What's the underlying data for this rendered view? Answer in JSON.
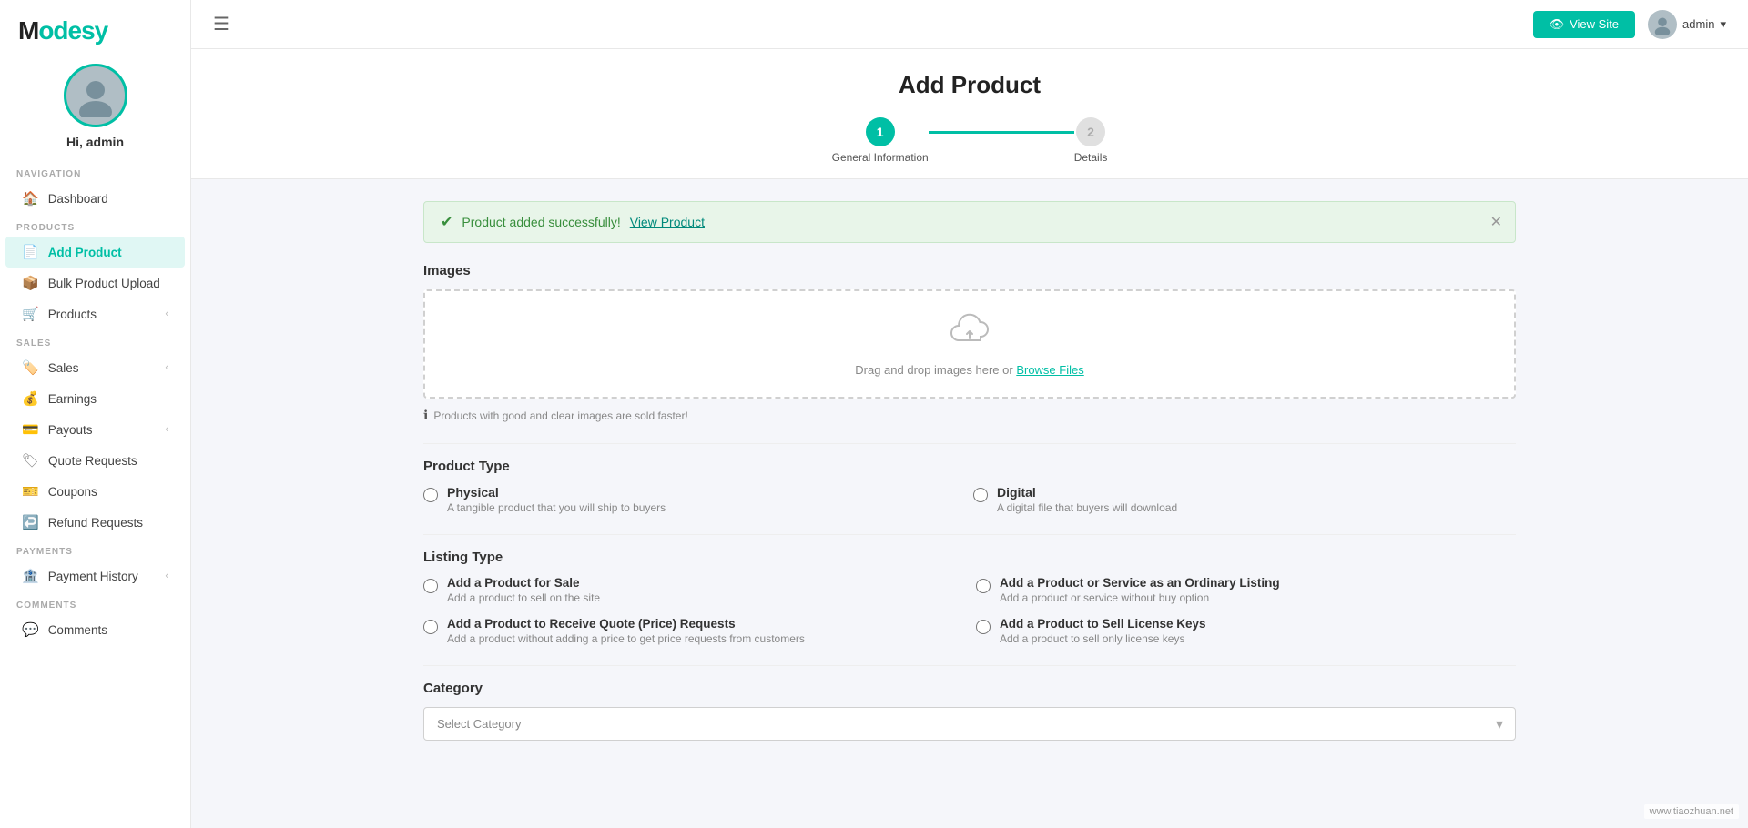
{
  "brand": {
    "name_start": "M",
    "name_rest": "odesy"
  },
  "sidebar": {
    "greeting": "Hi, admin",
    "sections": [
      {
        "label": "NAVIGATION",
        "items": [
          {
            "id": "dashboard",
            "icon": "🏠",
            "text": "Dashboard",
            "active": false,
            "chevron": false
          }
        ]
      },
      {
        "label": "PRODUCTS",
        "items": [
          {
            "id": "add-product",
            "icon": "📄",
            "text": "Add Product",
            "active": true,
            "chevron": false
          },
          {
            "id": "bulk-upload",
            "icon": "📦",
            "text": "Bulk Product Upload",
            "active": false,
            "chevron": false
          },
          {
            "id": "products",
            "icon": "🛒",
            "text": "Products",
            "active": false,
            "chevron": true
          }
        ]
      },
      {
        "label": "SALES",
        "items": [
          {
            "id": "sales",
            "icon": "🏷️",
            "text": "Sales",
            "active": false,
            "chevron": true
          },
          {
            "id": "earnings",
            "icon": "💰",
            "text": "Earnings",
            "active": false,
            "chevron": false
          },
          {
            "id": "payouts",
            "icon": "💳",
            "text": "Payouts",
            "active": false,
            "chevron": true
          },
          {
            "id": "quote-requests",
            "icon": "🏷",
            "text": "Quote Requests",
            "active": false,
            "chevron": false
          },
          {
            "id": "coupons",
            "icon": "🎫",
            "text": "Coupons",
            "active": false,
            "chevron": false
          },
          {
            "id": "refund-requests",
            "icon": "↩️",
            "text": "Refund Requests",
            "active": false,
            "chevron": false
          }
        ]
      },
      {
        "label": "PAYMENTS",
        "items": [
          {
            "id": "payment-history",
            "icon": "🏦",
            "text": "Payment History",
            "active": false,
            "chevron": true
          }
        ]
      },
      {
        "label": "COMMENTS",
        "items": [
          {
            "id": "comments",
            "icon": "💬",
            "text": "Comments",
            "active": false,
            "chevron": false
          }
        ]
      }
    ]
  },
  "topbar": {
    "view_site_label": "View Site",
    "admin_label": "admin"
  },
  "page": {
    "title": "Add Product",
    "stepper": [
      {
        "number": "1",
        "label": "General Information",
        "active": true
      },
      {
        "number": "2",
        "label": "Details",
        "active": false
      }
    ],
    "alert": {
      "text": "Product added successfully!",
      "link_text": "View Product"
    },
    "images_section": "Images",
    "upload_hint": "Products with good and clear images are sold faster!",
    "upload_placeholder": "Drag and drop images here or",
    "upload_browse": "Browse Files",
    "product_type_section": "Product Type",
    "product_types": [
      {
        "id": "physical",
        "label": "Physical",
        "desc": "A tangible product that you will ship to buyers"
      },
      {
        "id": "digital",
        "label": "Digital",
        "desc": "A digital file that buyers will download"
      }
    ],
    "listing_type_section": "Listing Type",
    "listing_types": [
      {
        "id": "sale",
        "label": "Add a Product for Sale",
        "desc": "Add a product to sell on the site"
      },
      {
        "id": "ordinary",
        "label": "Add a Product or Service as an Ordinary Listing",
        "desc": "Add a product or service without buy option"
      },
      {
        "id": "quote",
        "label": "Add a Product to Receive Quote (Price) Requests",
        "desc": "Add a product without adding a price to get price requests from customers"
      },
      {
        "id": "license",
        "label": "Add a Product to Sell License Keys",
        "desc": "Add a product to sell only license keys"
      }
    ],
    "category_section": "Category",
    "category_placeholder": "Select Category"
  },
  "watermark": "www.tiaozhuan.net"
}
